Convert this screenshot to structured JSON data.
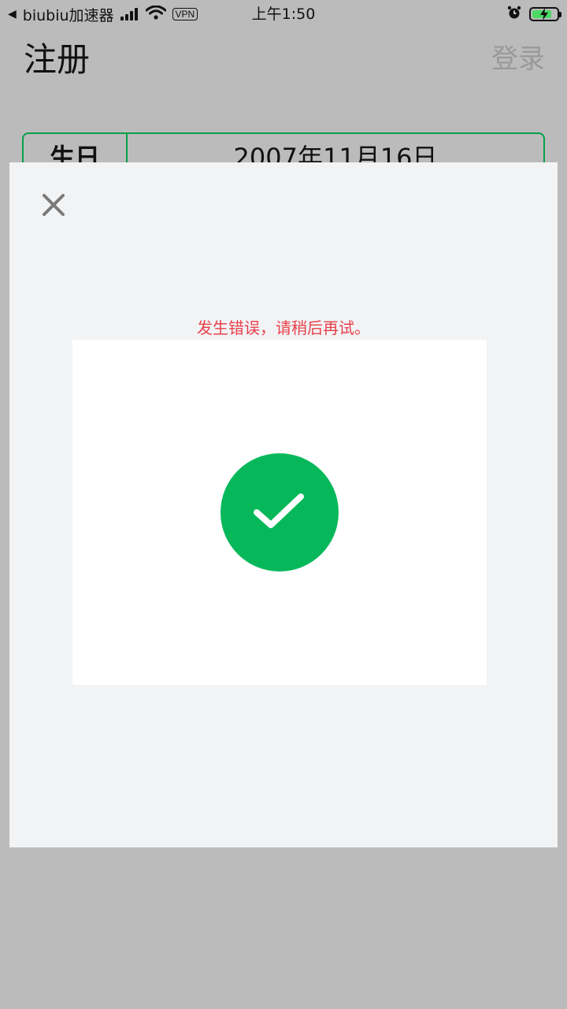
{
  "status_bar": {
    "back_arrow": "◀",
    "app_name": "biubiu加速器",
    "vpn_label": "VPN",
    "time": "上午1:50",
    "icons": [
      "signal-icon",
      "wifi-icon",
      "alarm-icon",
      "battery-charging-icon"
    ]
  },
  "header": {
    "title": "注册",
    "login_label": "登录"
  },
  "form": {
    "birthday_label": "生日",
    "birthday_value": "2007年11月16日"
  },
  "modal": {
    "close_icon": "close-icon",
    "error_message": "发生错误，请稍后再试。",
    "status_icon": "check-circle-icon"
  },
  "colors": {
    "accent_green": "#07b85a",
    "error_red": "#e8414a",
    "overlay_gray": "#bbbbbb",
    "modal_bg": "#f2f3f5"
  }
}
